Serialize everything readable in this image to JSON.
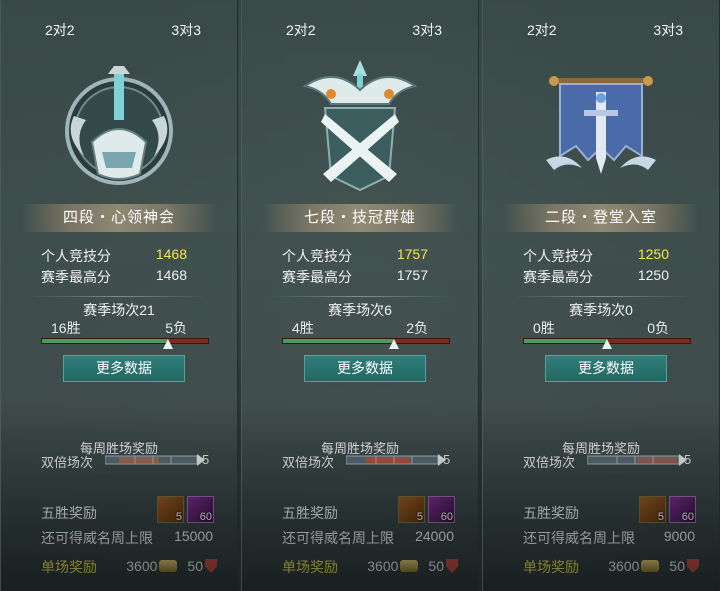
{
  "panels": [
    {
      "tab_left": "2对2",
      "tab_right": "3对3",
      "rank_title": "四段・心领神会",
      "personal_score_label": "个人竞技分",
      "personal_score": "1468",
      "season_high_label": "赛季最高分",
      "season_high": "1468",
      "season_matches": "赛季场次21",
      "wins": "16胜",
      "losses": "5负",
      "win_fraction": 0.76,
      "more_data": "更多数据",
      "weekly_reward_title": "每周胜场奖励",
      "double_label": "双倍场次",
      "double_count": "5",
      "five_win_label": "五胜奖励",
      "item_a_count": "5",
      "item_b_count": "60",
      "prestige_cap_label": "还可得威名周上限",
      "prestige_cap": "15000",
      "single_reward_label": "单场奖励",
      "coin_reward": "3600",
      "shield_reward": "50",
      "emblem_icon": "sword-helmet-emblem-icon"
    },
    {
      "tab_left": "2对2",
      "tab_right": "3对3",
      "rank_title": "七段・技冠群雄",
      "personal_score_label": "个人竞技分",
      "personal_score": "1757",
      "season_high_label": "赛季最高分",
      "season_high": "1757",
      "season_matches": "赛季场次6",
      "wins": "4胜",
      "losses": "2负",
      "win_fraction": 0.67,
      "more_data": "更多数据",
      "weekly_reward_title": "每周胜场奖励",
      "double_label": "双倍场次",
      "double_count": "5",
      "five_win_label": "五胜奖励",
      "item_a_count": "5",
      "item_b_count": "60",
      "prestige_cap_label": "还可得威名周上限",
      "prestige_cap": "24000",
      "single_reward_label": "单场奖励",
      "coin_reward": "3600",
      "shield_reward": "50",
      "emblem_icon": "crossed-swords-emblem-icon"
    },
    {
      "tab_left": "2对2",
      "tab_right": "3对3",
      "rank_title": "二段・登堂入室",
      "personal_score_label": "个人竞技分",
      "personal_score": "1250",
      "season_high_label": "赛季最高分",
      "season_high": "1250",
      "season_matches": "赛季场次0",
      "wins": "0胜",
      "losses": "0负",
      "win_fraction": 0.5,
      "more_data": "更多数据",
      "weekly_reward_title": "每周胜场奖励",
      "double_label": "双倍场次",
      "double_count": "5",
      "five_win_label": "五胜奖励",
      "item_a_count": "5",
      "item_b_count": "60",
      "prestige_cap_label": "还可得威名周上限",
      "prestige_cap": "9000",
      "single_reward_label": "单场奖励",
      "coin_reward": "3600",
      "shield_reward": "50",
      "emblem_icon": "banner-sword-emblem-icon"
    }
  ],
  "colors": {
    "score_highlight": "#f3e64a",
    "win_bar": "#4c9a5c",
    "loss_bar": "#7b2a1e",
    "button": "#2f7f7a"
  }
}
